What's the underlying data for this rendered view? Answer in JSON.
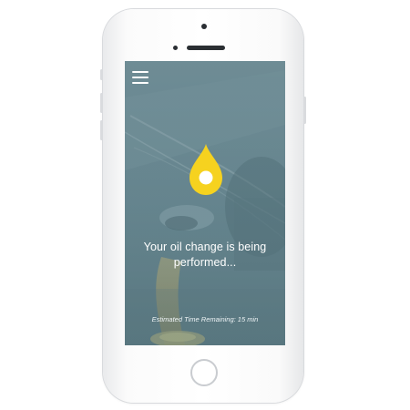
{
  "app": {
    "status_message": "Your oil change is being performed...",
    "eta_text": "Estimated Time Remaining: 15 min"
  },
  "icons": {
    "menu": "hamburger-menu-icon",
    "status": "oil-drop-icon"
  },
  "colors": {
    "accent_yellow": "#f6d21f",
    "overlay_teal": "#6c8a93",
    "text": "#ffffff"
  }
}
